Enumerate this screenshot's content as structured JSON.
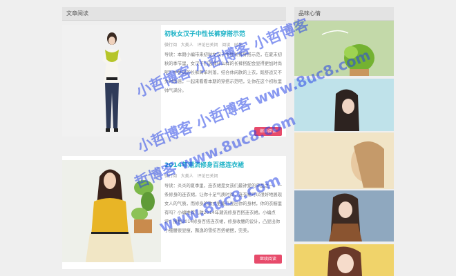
{
  "main": {
    "section_title": "文章阅读",
    "articles": [
      {
        "title": "初秋女汉子中性长裤穿搭示范",
        "meta": [
          "微行阅",
          "大美人",
          "评论已关闭",
          "阅读",
          "时尚"
        ],
        "excerpt": "导读：本期小编带来初秋女汉子中性长裤穿搭示范，在夏末初秋的季节里，女汉子们选择什么样的长裤搭配会显得更加时尚呢？中性风的长裤简单利落，结合休闲款的上衣，既舒适又不失时尚感，一起来看看本期的穿搭示范吧，让你在这个初秋里帅气满分。",
        "button": "继续阅读"
      },
      {
        "title": "2014年潮流修身百搭连衣裙",
        "meta": [
          "微行阅",
          "大美人",
          "评论已关闭"
        ],
        "excerpt": "导读：炎炎的夏季里，连衣裙是女孩们最钟爱的单品之一，一条修身的连衣裙，让你十足气质时尚，连衣裙可以很好地展现女人的气质，而修身的款式更能凸显出你的身材，你的衣橱里有吗？小编推荐几款2014年潮流修身百搭连衣裙。小编点评：撞色2014修身百搭连衣裙，修身收腰的设计，凸显出你小细腰很显瘦，飘逸的雪纺百搭裙摆，完美。",
        "button": "继续阅读"
      }
    ]
  },
  "sidebar": {
    "section_title": "品味心情",
    "images": [
      "四叶草盆栽",
      "短发女孩",
      "遮脸女孩",
      "背带裙女孩",
      "微笑女孩"
    ]
  },
  "watermark": {
    "lines": [
      "小哲博客 小哲博客 小哲博客",
      "小哲博客 小哲博客 www.8uc8.com",
      "哲博客 www.8uc8.com",
      "www.8uc8.com"
    ]
  },
  "colors": {
    "title": "#1fb3c7",
    "button": "#e74b6b",
    "watermark": "#2846e6"
  }
}
